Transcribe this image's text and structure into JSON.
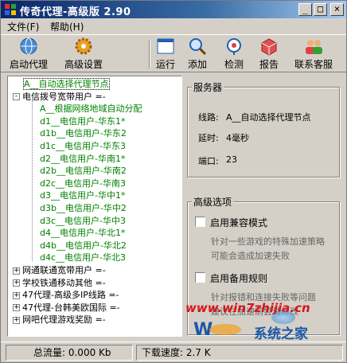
{
  "window": {
    "title": "传奇代理-高级版 2.90",
    "buttons": {
      "minimize": "_",
      "maximize": "□",
      "close": "×"
    }
  },
  "menu": {
    "items": [
      "文件(F)",
      "帮助(H)"
    ]
  },
  "toolbar": {
    "start": "启动代理",
    "advanced": "高级设置",
    "run": "运行",
    "add": "添加",
    "detect": "检测",
    "report": "报告",
    "support": "联系客服"
  },
  "tree": {
    "nodes": [
      {
        "text": "A__自动选择代理节点",
        "color": "green",
        "level": 0,
        "expander": ""
      },
      {
        "text": "电信拨号宽带用户 =-",
        "color": "black",
        "level": 0,
        "expander": "-"
      },
      {
        "text": "A__根据网络地域自动分配",
        "color": "green",
        "level": 1,
        "expander": ""
      },
      {
        "text": "d1__电信用户-华东1*",
        "color": "green",
        "level": 1,
        "expander": ""
      },
      {
        "text": "d1b__电信用户-华东2",
        "color": "green",
        "level": 1,
        "expander": ""
      },
      {
        "text": "d1c__电信用户-华东3",
        "color": "green",
        "level": 1,
        "expander": ""
      },
      {
        "text": "d2__电信用户-华南1*",
        "color": "green",
        "level": 1,
        "expander": ""
      },
      {
        "text": "d2b__电信用户-华南2",
        "color": "green",
        "level": 1,
        "expander": ""
      },
      {
        "text": "d2c__电信用户-华南3",
        "color": "green",
        "level": 1,
        "expander": ""
      },
      {
        "text": "d3__电信用户-华中1*",
        "color": "green",
        "level": 1,
        "expander": ""
      },
      {
        "text": "d3b__电信用户-华中2",
        "color": "green",
        "level": 1,
        "expander": ""
      },
      {
        "text": "d3c__电信用户-华中3",
        "color": "green",
        "level": 1,
        "expander": ""
      },
      {
        "text": "d4__电信用户-华北1*",
        "color": "green",
        "level": 1,
        "expander": ""
      },
      {
        "text": "d4b__电信用户-华北2",
        "color": "green",
        "level": 1,
        "expander": ""
      },
      {
        "text": "d4c__电信用户-华北3",
        "color": "green",
        "level": 1,
        "expander": ""
      },
      {
        "text": "网通联通宽带用户 =-",
        "color": "black",
        "level": 0,
        "expander": "+"
      },
      {
        "text": "学校铁通移动其他 =-",
        "color": "black",
        "level": 0,
        "expander": "+"
      },
      {
        "text": "47代理-高级多IP线路 =-",
        "color": "black",
        "level": 0,
        "expander": "+"
      },
      {
        "text": "47代理-台韩美欧国际 =-",
        "color": "black",
        "level": 0,
        "expander": "+"
      },
      {
        "text": "网吧代理游戏奖励 =-",
        "color": "black",
        "level": 0,
        "expander": "+"
      }
    ]
  },
  "server": {
    "title": "服务器",
    "line_label": "线路:",
    "line_value": "A__自动选择代理节点",
    "delay_label": "延时:",
    "delay_value": "4毫秒",
    "port_label": "端口:",
    "port_value": "23"
  },
  "advanced": {
    "title": "高级选项",
    "compat_label": "启用兼容模式",
    "compat_desc1": "针对一些游戏的特殊加速策略",
    "compat_desc2": "可能会造成加速失败",
    "backup_label": "启用备用规则",
    "backup_desc1": "针对报错和连接失败等问题",
    "backup_desc2": "建议在加速前尝试修改"
  },
  "status": {
    "total": "总流量: 0.000 Kb",
    "download": "下载速度: 2.7 K"
  },
  "watermark": {
    "url": "www.win7zhijia.cn",
    "logo": "W",
    "brand": "系统之家"
  },
  "colors": {
    "tree_green": "#008000",
    "title_bar": "#0a246a",
    "watermark_red": "#d7151b"
  }
}
